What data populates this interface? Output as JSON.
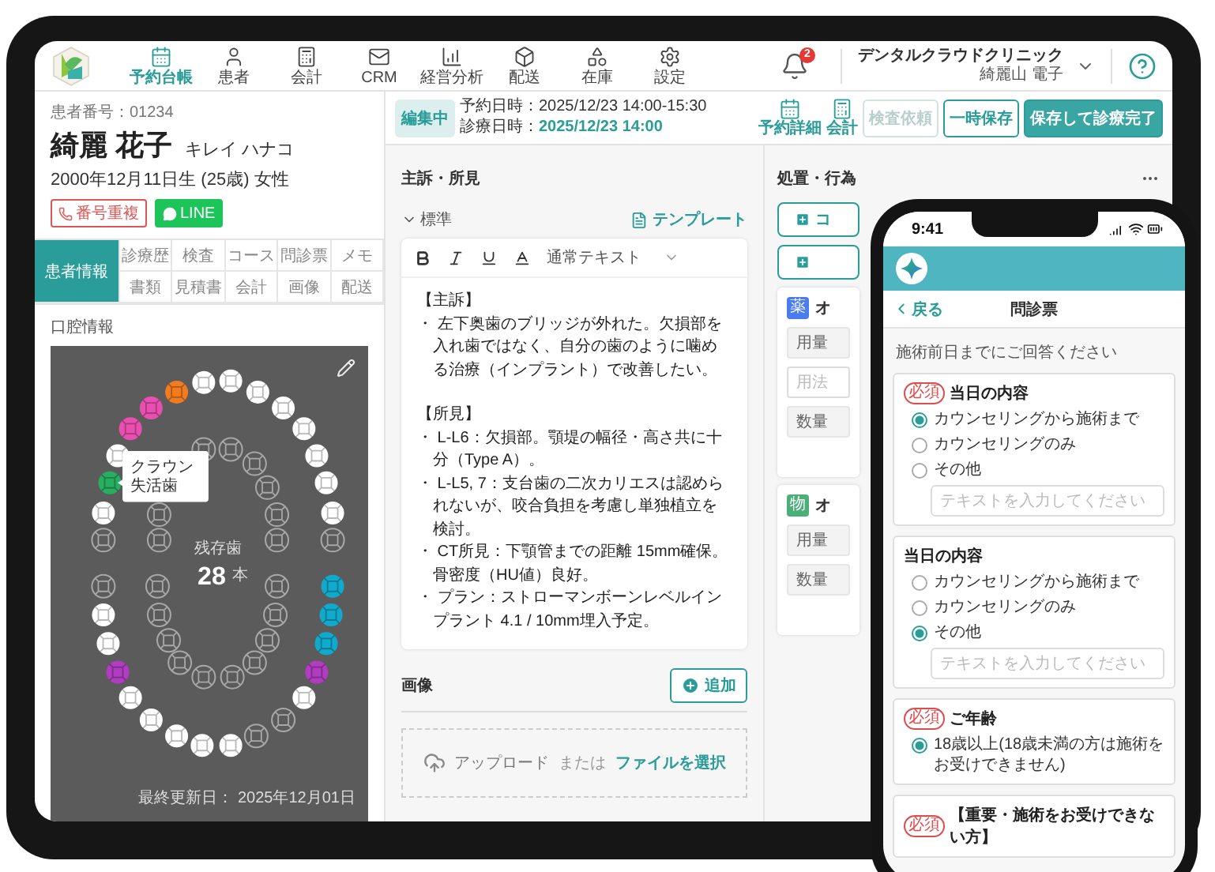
{
  "tablet": {
    "nav": {
      "items": [
        {
          "label": "予約台帳",
          "kind": "calendar",
          "selected": true
        },
        {
          "label": "患者",
          "kind": "user",
          "selected": false
        },
        {
          "label": "会計",
          "kind": "calculator",
          "selected": false
        },
        {
          "label": "CRM",
          "kind": "mail",
          "selected": false
        },
        {
          "label": "経営分析",
          "kind": "chart",
          "selected": false
        },
        {
          "label": "配送",
          "kind": "box",
          "selected": false
        },
        {
          "label": "在庫",
          "kind": "shapes",
          "selected": false
        },
        {
          "label": "設定",
          "kind": "settings",
          "selected": false
        }
      ],
      "notifications": "2",
      "clinic_name": "デンタルクラウドクリニック",
      "user_name": "綺麗山 電子"
    },
    "patient": {
      "number": "患者番号：01234",
      "name": "綺麗 花子",
      "kana": "キレイ ハナコ",
      "birth": "2000年12月11日生 (25歳) 女性",
      "tags": [
        {
          "label": "番号重複",
          "kind": "phone"
        },
        {
          "label": "LINE",
          "kind": "line"
        }
      ]
    },
    "tabs": [
      {
        "label": "患者情報",
        "selected": true
      },
      {
        "label": "診療歴",
        "selected": false
      },
      {
        "label": "検査",
        "selected": false
      },
      {
        "label": "コース",
        "selected": false
      },
      {
        "label": "問診票",
        "selected": false
      },
      {
        "label": "メモ",
        "selected": false
      },
      {
        "label": "書類",
        "selected": false
      },
      {
        "label": "見積書",
        "selected": false
      },
      {
        "label": "会計",
        "selected": false
      },
      {
        "label": "画像",
        "selected": false
      },
      {
        "label": "配送",
        "selected": false
      }
    ],
    "oral": {
      "title": "口腔情報",
      "remaining_label": "残存歯",
      "remaining_count": "28",
      "remaining_unit": "本",
      "tooltip": [
        "クラウン",
        "失活歯"
      ],
      "updated": "最終更新日： 2025年12月01日",
      "teeth": [
        {
          "missing": true
        },
        {
          "missing": false,
          "color": "#ffffff"
        },
        {
          "missing": false,
          "color": "#27ae60"
        },
        {
          "missing": false,
          "color": "#ffffff"
        },
        {
          "missing": false,
          "color": "#e94fb0"
        },
        {
          "missing": false,
          "color": "#e94fb0"
        },
        {
          "missing": false,
          "color": "#f27b1f"
        },
        {
          "missing": false,
          "color": "#ffffff"
        },
        {
          "missing": false,
          "color": "#ffffff"
        },
        {
          "missing": false,
          "color": "#ffffff"
        },
        {
          "missing": false,
          "color": "#ffffff"
        },
        {
          "missing": false,
          "color": "#ffffff"
        },
        {
          "missing": false,
          "color": "#ffffff"
        },
        {
          "missing": false,
          "color": "#ffffff"
        },
        {
          "missing": false,
          "color": "#ffffff"
        },
        {
          "missing": true
        },
        {
          "missing": false,
          "color": "#11a9cc"
        },
        {
          "missing": false,
          "color": "#11a9cc"
        },
        {
          "missing": false,
          "color": "#11a9cc"
        },
        {
          "missing": false,
          "color": "#b03cc0"
        },
        {
          "missing": false,
          "color": "#ffffff"
        },
        {
          "missing": true
        },
        {
          "missing": true
        },
        {
          "missing": false,
          "color": "#ffffff"
        },
        {
          "missing": false,
          "color": "#ffffff"
        },
        {
          "missing": false,
          "color": "#ffffff"
        },
        {
          "missing": false,
          "color": "#ffffff"
        },
        {
          "missing": false,
          "color": "#ffffff"
        },
        {
          "missing": false,
          "color": "#b03cc0"
        },
        {
          "missing": false,
          "color": "#ffffff"
        },
        {
          "missing": false,
          "color": "#ffffff"
        },
        {
          "missing": true
        }
      ]
    },
    "record": {
      "status": "編集中",
      "reserved": "予約日時：2025/12/23 14:00-15:30",
      "visit_label": "診療日時：",
      "visit_value": "2025/12/23 14:00",
      "icon_buttons": [
        {
          "label": "予約詳細",
          "kind": "calendar"
        },
        {
          "label": "会計",
          "kind": "calculator"
        }
      ],
      "buttons": [
        {
          "label": "検査依頼",
          "kind": "secondary",
          "disabled": true
        },
        {
          "label": "一時保存",
          "kind": "secondary",
          "disabled": false
        },
        {
          "label": "保存して診療完了",
          "kind": "primary",
          "disabled": false
        }
      ]
    },
    "findings": {
      "title": "主訴・所見",
      "template_set": "標準",
      "template_button": "テンプレート",
      "style_label": "通常テキスト",
      "sections": [
        {
          "heading": "【主訴】",
          "bullets": [
            "・ 左下奥歯のブリッジが外れた。欠損部を入れ歯ではなく、自分の歯のように噛める治療（インプラント）で改善したい。"
          ]
        },
        {
          "heading": "【所見】",
          "bullets": [
            "・ L-L6：欠損部。顎堤の幅径・高さ共に十分（Type A）。",
            "・ L-L5, 7：支台歯の二次カリエスは認められないが、咬合負担を考慮し単独植立を検討。",
            "・ CT所見：下顎管までの距離 15mm確保。骨密度（HU値）良好。",
            "・ プラン：ストローマンボーンレベルインプラント 4.1 / 10mm埋入予定。"
          ]
        }
      ]
    },
    "images": {
      "title": "画像",
      "add_button": "追加",
      "upload": "アップロード",
      "or": "または",
      "choose": "ファイルを選択"
    },
    "treatment": {
      "title": "処置・行為",
      "buttons": [
        {
          "kind": "text",
          "label": "コ"
        },
        {
          "kind": "icon"
        }
      ],
      "cards": [
        {
          "badge": "薬",
          "color": "#4a7cf0",
          "title": "オ",
          "fields": [
            {
              "kind": "label",
              "label": "用量"
            },
            {
              "kind": "input",
              "placeholder": "用法"
            },
            {
              "kind": "label",
              "label": "数量"
            }
          ]
        },
        {
          "badge": "物",
          "color": "#4caf7a",
          "title": "オ",
          "fields": [
            {
              "kind": "label",
              "label": "用量"
            },
            {
              "kind": "label",
              "label": "数量"
            }
          ]
        }
      ]
    }
  },
  "phone": {
    "time": "9:41",
    "back": "戻る",
    "title": "問診票",
    "intro": "施術前日までにご回答ください",
    "questions": [
      {
        "badge": "必須",
        "title": "当日の内容",
        "options": [
          {
            "label": "カウンセリングから施術まで",
            "selected": true
          },
          {
            "label": "カウンセリングのみ",
            "selected": false
          },
          {
            "label": "その他",
            "selected": false
          }
        ],
        "placeholder": "テキストを入力してください"
      },
      {
        "title": "当日の内容",
        "options": [
          {
            "label": "カウンセリングから施術まで",
            "selected": false
          },
          {
            "label": "カウンセリングのみ",
            "selected": false
          },
          {
            "label": "その他",
            "selected": true
          }
        ],
        "placeholder": "テキストを入力してください"
      },
      {
        "badge": "必須",
        "title": "ご年齢",
        "options": [
          {
            "label": "18歳以上(18歳未満の方は施術をお受けできません)",
            "selected": true
          }
        ]
      },
      {
        "badge": "必須",
        "title": "【重要・施術をお受けできない方】"
      }
    ]
  }
}
